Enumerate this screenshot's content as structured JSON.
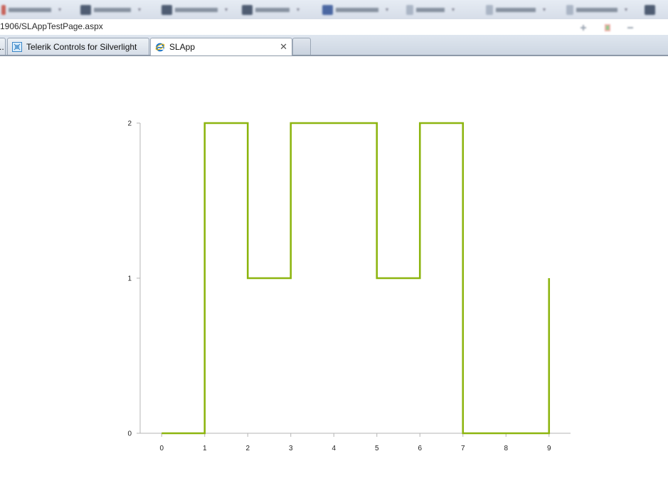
{
  "address": {
    "url": "1906/SLAppTestPage.aspx"
  },
  "tabs": [
    {
      "label": "..",
      "active": false
    },
    {
      "label": "Telerik Controls for Silverlight",
      "active": false
    },
    {
      "label": "SLApp",
      "active": true
    }
  ],
  "icons": {
    "telerik_tab": "silverlight-page-icon",
    "slapp_tab": "internet-explorer-icon",
    "close": "close-icon"
  },
  "colors": {
    "series": "#8db510",
    "axis": "#b4b4b4",
    "ie_blue": "#1a73c7"
  },
  "chart_data": {
    "type": "line",
    "interpolation": "step",
    "x": [
      0,
      1,
      2,
      3,
      4,
      5,
      6,
      7,
      8,
      9
    ],
    "y": [
      0,
      2,
      1,
      2,
      2,
      1,
      2,
      0,
      0,
      1
    ],
    "x_ticks": [
      "0",
      "1",
      "2",
      "3",
      "4",
      "5",
      "6",
      "7",
      "8",
      "9"
    ],
    "y_ticks": [
      "0",
      "1",
      "2"
    ],
    "xlim": [
      -0.5,
      9.5
    ],
    "ylim": [
      0,
      2
    ],
    "title": "",
    "xlabel": "",
    "ylabel": "",
    "grid": false,
    "legend": "none"
  }
}
